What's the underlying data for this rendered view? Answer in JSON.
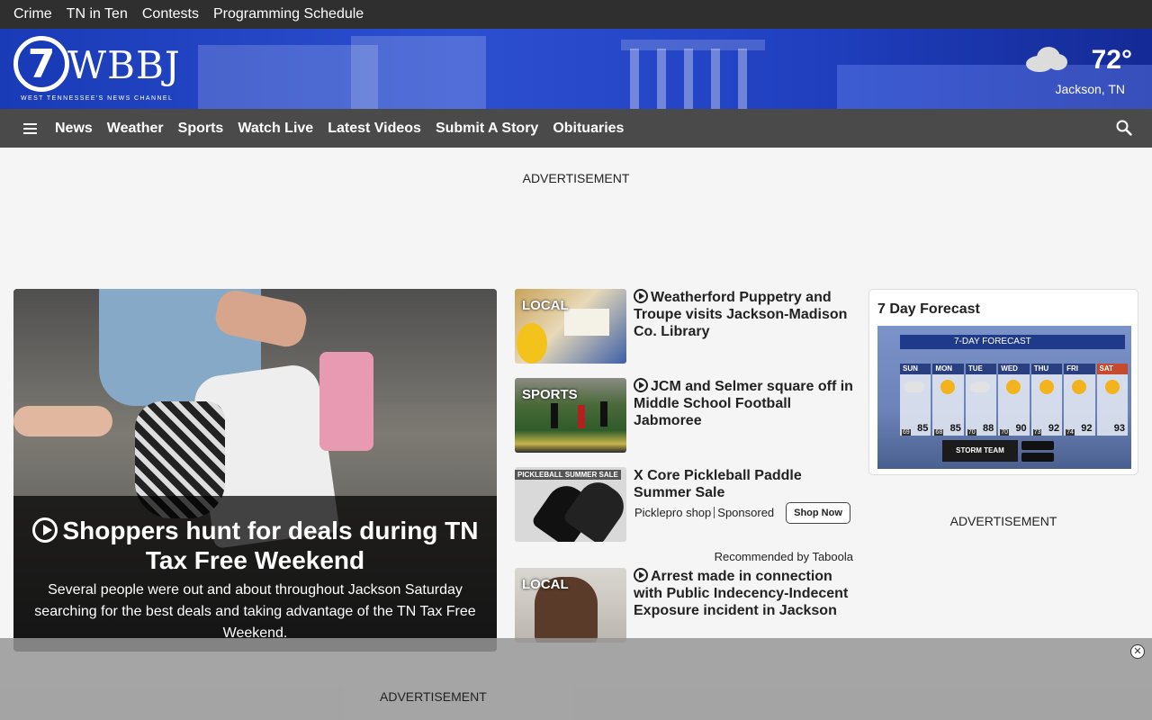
{
  "topbar": {
    "links": [
      "Crime",
      "TN in Ten",
      "Contests",
      "Programming Schedule"
    ]
  },
  "header": {
    "logo_number": "7",
    "logo_letters": "WBBJ",
    "logo_tagline": "WEST TENNESSEE'S NEWS CHANNEL",
    "weather": {
      "temp": "72°",
      "location": "Jackson, TN",
      "icon": "cloudy-icon"
    }
  },
  "nav": {
    "items": [
      "News",
      "Weather",
      "Sports",
      "Watch Live",
      "Latest Videos",
      "Submit A Story",
      "Obituaries"
    ]
  },
  "ads": {
    "top_label": "ADVERTISEMENT",
    "right_label": "ADVERTISEMENT",
    "bottom_label": "ADVERTISEMENT"
  },
  "hero": {
    "title": "Shoppers hunt for deals during TN Tax Free Weekend",
    "summary": "Several people were out and about throughout Jackson Saturday searching for the best deals and taking advantage of the TN Tax Free Weekend."
  },
  "stories": [
    {
      "tag": "LOCAL",
      "headline": "Weatherford Puppetry and Troupe visits Jackson-Madison Co. Library",
      "video": true
    },
    {
      "tag": "SPORTS",
      "headline": "JCM and Selmer square off in Middle School Football Jabmoree",
      "video": true
    },
    {
      "tag": "",
      "headline": "X Core Pickleball Paddle Summer Sale",
      "video": false,
      "sponsor": "Picklepro shop",
      "sponsored_label": "Sponsored",
      "cta": "Shop Now",
      "thumb_text": "PICKLEBALL SUMMER SALE"
    },
    {
      "tag": "LOCAL",
      "headline": "Arrest made in connection with Public Indecency-Indecent Exposure incident in Jackson",
      "video": true
    }
  ],
  "taboola": "Recommended by Taboola",
  "forecast": {
    "title": "7 Day Forecast",
    "graphic_header": "7-DAY FORECAST",
    "graphic_brand": "STORM TEAM WEATHER",
    "days": [
      {
        "day": "SUN",
        "hi": "85",
        "lo": "69",
        "icon": "cloud-rain-icon"
      },
      {
        "day": "MON",
        "hi": "85",
        "lo": "68",
        "icon": "sun-icon"
      },
      {
        "day": "TUE",
        "hi": "88",
        "lo": "70",
        "icon": "cloud-icon"
      },
      {
        "day": "WED",
        "hi": "90",
        "lo": "70",
        "icon": "sun-icon"
      },
      {
        "day": "THU",
        "hi": "92",
        "lo": "73",
        "icon": "sun-icon"
      },
      {
        "day": "FRI",
        "hi": "92",
        "lo": "74",
        "icon": "sun-icon"
      },
      {
        "day": "SAT",
        "hi": "93",
        "lo": "",
        "icon": "sun-icon"
      }
    ]
  },
  "colors": {
    "banner_blue": "#2040c0",
    "nav_bg": "#4a4a4a",
    "topbar_bg": "#2f2f2f"
  }
}
